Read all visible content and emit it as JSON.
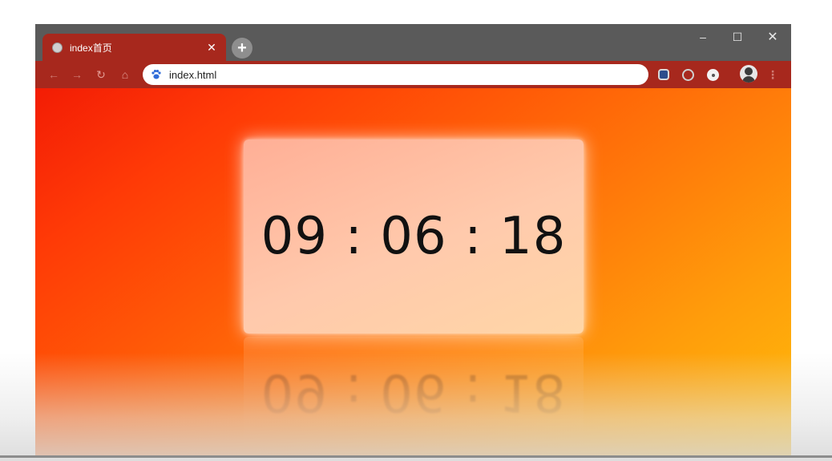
{
  "browser": {
    "tab": {
      "title": "index首页",
      "close_glyph": "✕",
      "favicon": "globe-icon"
    },
    "new_tab_glyph": "+",
    "window_controls": {
      "minimize": "–",
      "maximize": "☐",
      "close": "✕"
    },
    "nav": {
      "back": "←",
      "forward": "→",
      "reload": "↻",
      "home": "⌂"
    },
    "address": {
      "url": "index.html",
      "site_icon": "paw-icon"
    },
    "menu_glyph": "⋮"
  },
  "page": {
    "clock": {
      "time": "09 : 06 : 18"
    },
    "background_colors": [
      "#f31c05",
      "#ffbd0a"
    ]
  }
}
